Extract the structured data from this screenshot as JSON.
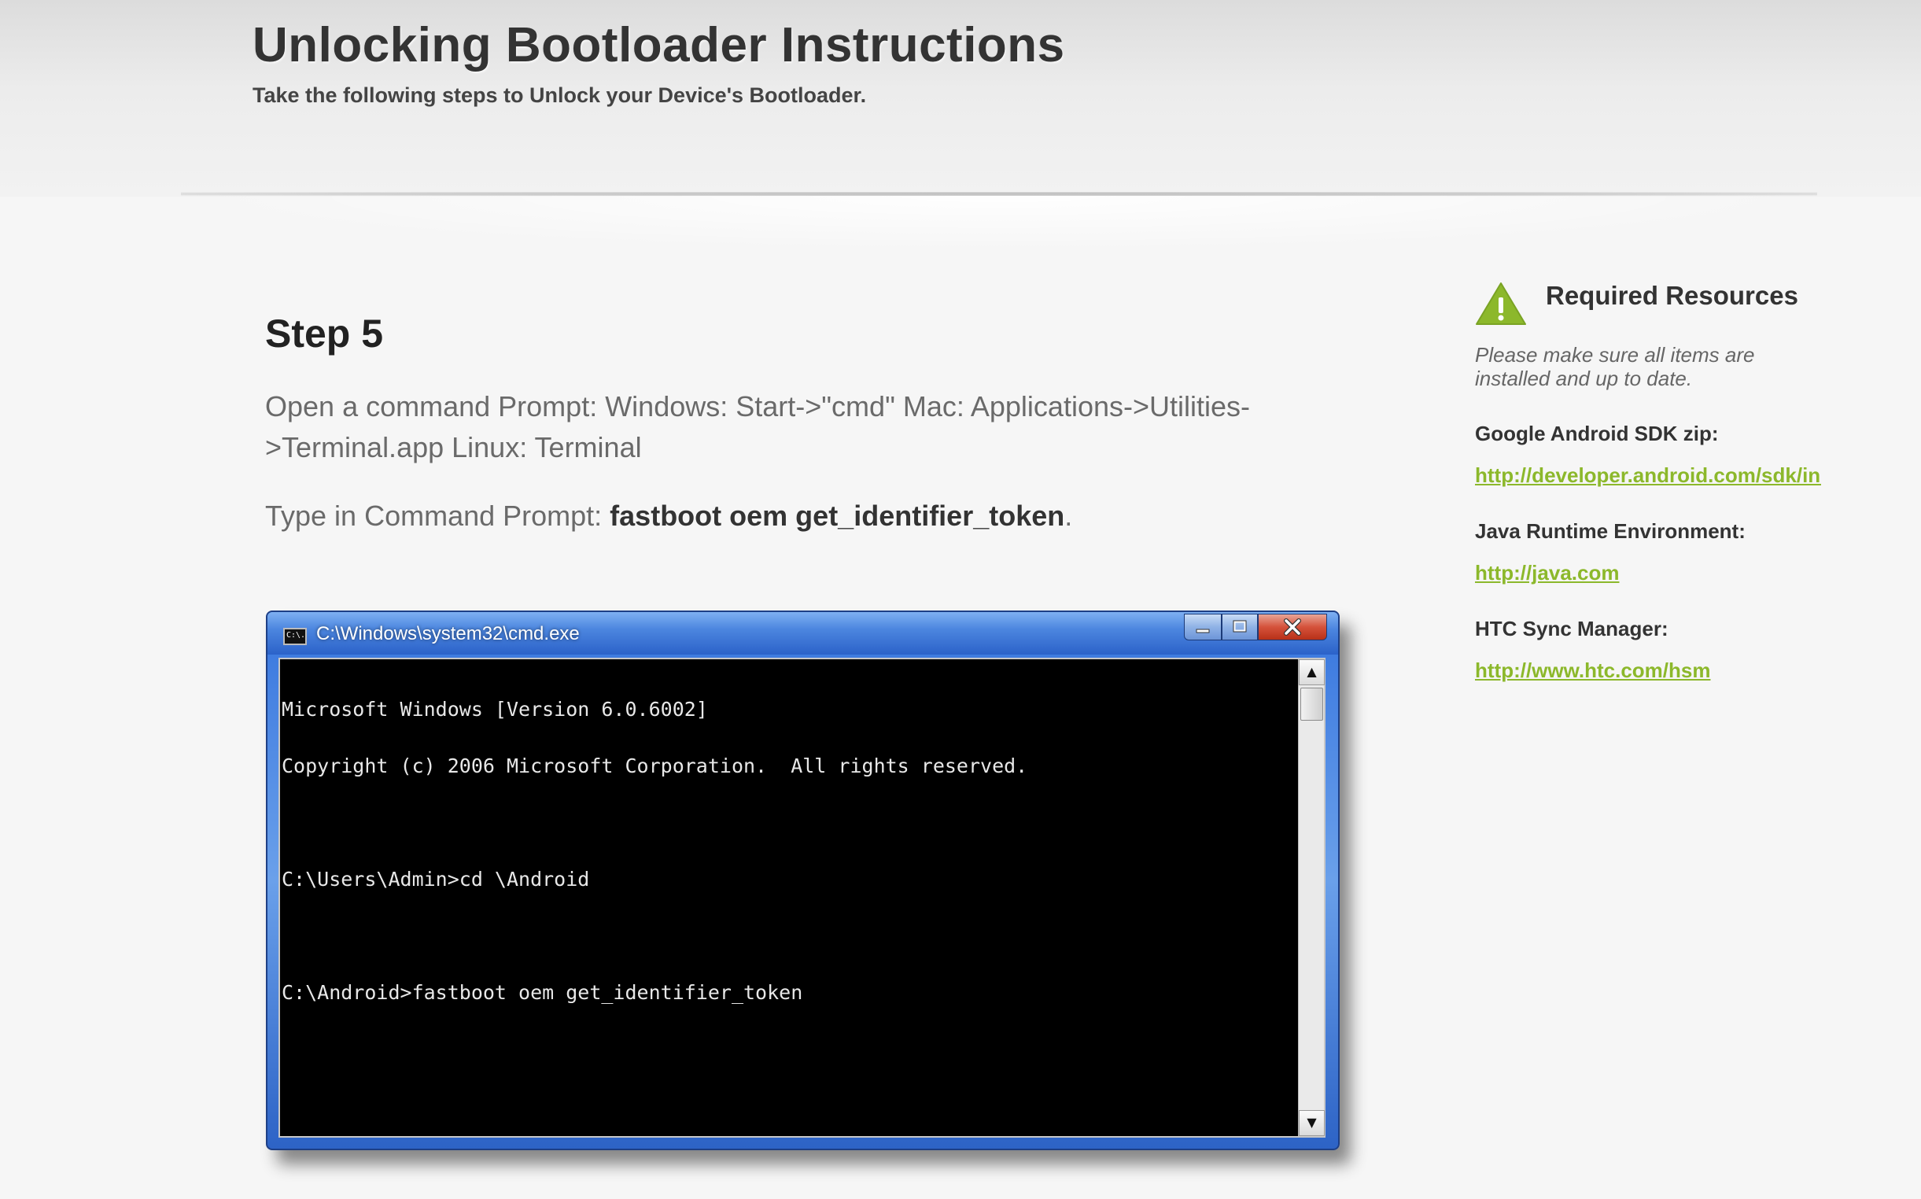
{
  "header": {
    "title": "Unlocking Bootloader Instructions",
    "subtitle": "Take the following steps to Unlock your Device's Bootloader."
  },
  "step": {
    "title": "Step 5",
    "instruction": "Open a command Prompt: Windows: Start->\"cmd\" Mac: Applications->Utilities->Terminal.app Linux: Terminal",
    "type_prefix": "Type in Command Prompt: ",
    "command": "fastboot oem get_identifier_token",
    "type_suffix": "."
  },
  "cmd_window": {
    "title": "C:\\Windows\\system32\\cmd.exe",
    "icon_text": "C:\\.",
    "icon": "cmd-icon",
    "controls": {
      "minimize": "minimize-icon",
      "maximize": "maximize-icon",
      "close": "close-icon"
    },
    "lines": [
      "Microsoft Windows [Version 6.0.6002]",
      "Copyright (c) 2006 Microsoft Corporation.  All rights reserved.",
      "",
      "C:\\Users\\Admin>cd \\Android",
      "",
      "C:\\Android>fastboot oem get_identifier_token"
    ]
  },
  "sidebar": {
    "icon": "warning-icon",
    "title": "Required Resources",
    "note": "Please make sure all items are installed and up to date.",
    "resources": [
      {
        "label": "Google Android SDK zip:",
        "link": "http://developer.android.com/sdk/index.html"
      },
      {
        "label": "Java Runtime Environment:",
        "link": "http://java.com"
      },
      {
        "label": "HTC Sync Manager:",
        "link": "http://www.htc.com/hsm"
      }
    ],
    "accent_color": "#8cb82b"
  }
}
